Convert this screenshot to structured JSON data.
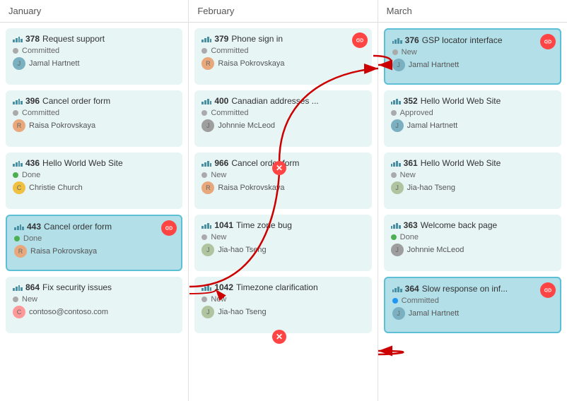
{
  "columns": [
    {
      "name": "January",
      "cards": [
        {
          "id": "378",
          "title": "Request support",
          "status": "Committed",
          "statusClass": "dot-committed",
          "user": "Jamal Hartnett",
          "userClass": "avatar-jamal",
          "highlighted": false,
          "hasLink": false
        },
        {
          "id": "396",
          "title": "Cancel order form",
          "status": "Committed",
          "statusClass": "dot-committed",
          "user": "Raisa Pokrovskaya",
          "userClass": "avatar-raisa",
          "highlighted": false,
          "hasLink": false
        },
        {
          "id": "436",
          "title": "Hello World Web Site",
          "status": "Done",
          "statusClass": "dot-done",
          "user": "Christie Church",
          "userClass": "avatar-christie",
          "highlighted": false,
          "hasLink": false
        },
        {
          "id": "443",
          "title": "Cancel order form",
          "status": "Done",
          "statusClass": "dot-done",
          "user": "Raisa Pokrovskaya",
          "userClass": "avatar-raisa",
          "highlighted": true,
          "hasLink": true
        },
        {
          "id": "864",
          "title": "Fix security issues",
          "status": "New",
          "statusClass": "dot-new",
          "user": "contoso@contoso.com",
          "userClass": "avatar-contoso",
          "highlighted": false,
          "hasLink": false
        }
      ]
    },
    {
      "name": "February",
      "cards": [
        {
          "id": "379",
          "title": "Phone sign in",
          "status": "Committed",
          "statusClass": "dot-committed",
          "user": "Raisa Pokrovskaya",
          "userClass": "avatar-raisa",
          "highlighted": false,
          "hasLink": true
        },
        {
          "id": "400",
          "title": "Canadian addresses ...",
          "status": "Committed",
          "statusClass": "dot-committed",
          "user": "Johnnie McLeod",
          "userClass": "avatar-johnnie",
          "highlighted": false,
          "hasLink": false
        },
        {
          "id": "966",
          "title": "Cancel order form",
          "status": "New",
          "statusClass": "dot-new",
          "user": "Raisa Pokrovskaya",
          "userClass": "avatar-raisa",
          "highlighted": false,
          "hasLink": false
        },
        {
          "id": "1041",
          "title": "Time zone bug",
          "status": "New",
          "statusClass": "dot-new",
          "user": "Jia-hao Tseng",
          "userClass": "avatar-jia",
          "highlighted": false,
          "hasLink": false
        },
        {
          "id": "1042",
          "title": "Timezone clarification",
          "status": "New",
          "statusClass": "dot-new",
          "user": "Jia-hao Tseng",
          "userClass": "avatar-jia",
          "highlighted": false,
          "hasLink": false
        }
      ]
    },
    {
      "name": "March",
      "cards": [
        {
          "id": "376",
          "title": "GSP locator interface",
          "status": "New",
          "statusClass": "dot-new",
          "user": "Jamal Hartnett",
          "userClass": "avatar-jamal",
          "highlighted": true,
          "hasLink": true
        },
        {
          "id": "352",
          "title": "Hello World Web Site",
          "status": "Approved",
          "statusClass": "dot-approved",
          "user": "Jamal Hartnett",
          "userClass": "avatar-jamal",
          "highlighted": false,
          "hasLink": false
        },
        {
          "id": "361",
          "title": "Hello World Web Site",
          "status": "New",
          "statusClass": "dot-new",
          "user": "Jia-hao Tseng",
          "userClass": "avatar-jia",
          "highlighted": false,
          "hasLink": false
        },
        {
          "id": "363",
          "title": "Welcome back page",
          "status": "Done",
          "statusClass": "dot-done",
          "user": "Johnnie McLeod",
          "userClass": "avatar-johnnie",
          "highlighted": false,
          "hasLink": false
        },
        {
          "id": "364",
          "title": "Slow response on inf...",
          "status": "Committed",
          "statusClass": "dot-committed-blue",
          "user": "Jamal Hartnett",
          "userClass": "avatar-jamal",
          "highlighted": true,
          "hasLink": true
        }
      ]
    }
  ],
  "icons": {
    "link": "🔗",
    "close": "✕"
  }
}
